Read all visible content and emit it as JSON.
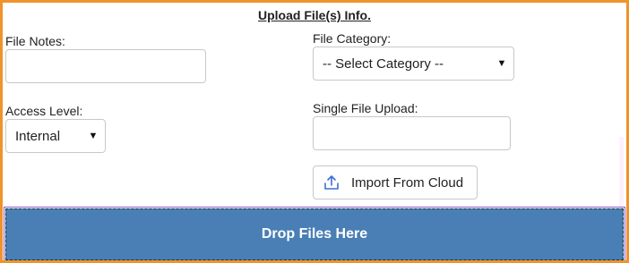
{
  "form": {
    "title": "Upload File(s) Info.",
    "file_notes": {
      "label": "File Notes:",
      "value": ""
    },
    "file_category": {
      "label": "File Category:",
      "selected": "-- Select Category --"
    },
    "access_level": {
      "label": "Access Level:",
      "selected": "Internal"
    },
    "single_upload": {
      "label": "Single File Upload:",
      "value": ""
    },
    "import_cloud": {
      "label": "Import From Cloud",
      "icon": "upload-icon"
    },
    "dropzone": {
      "label": "Drop Files Here"
    },
    "colors": {
      "frame_border": "#f0932b",
      "dropzone_bg": "#4a7fb5",
      "icon_accent": "#3b6fd4"
    }
  }
}
